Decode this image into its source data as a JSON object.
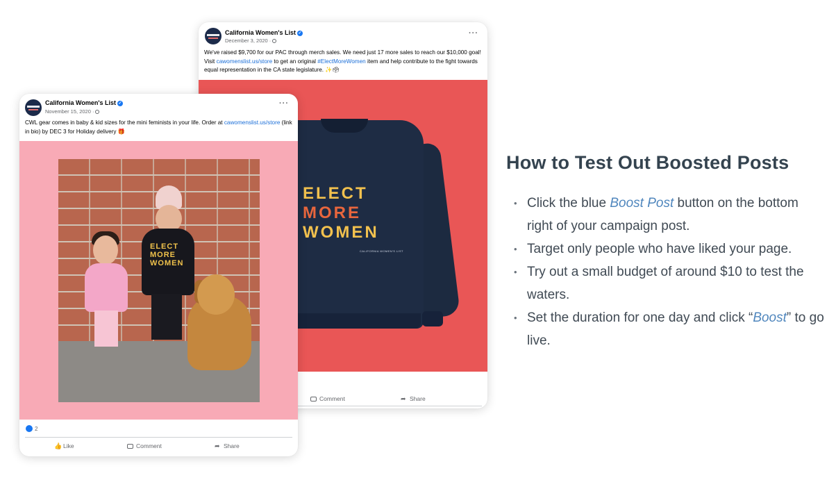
{
  "back_post": {
    "page_name": "California Women's List",
    "date": "December 3, 2020 ·",
    "text_1": "We've raised $9,700 for our PAC through merch sales. We need just 17 more sales to reach our $10,000 goal! Visit ",
    "link_1": "cawomenslist.us/store",
    "text_2": " to get an original ",
    "link_2": "#ElectMoreWomen",
    "text_3": " item and help contribute to the fight towards equal representation in the CA state legislature. ✨🗳",
    "shirt_print": [
      "ELECT",
      "MORE",
      "WOMEN"
    ],
    "shirt_tag": "CALIFORNIA WOMEN'S LIST",
    "comment_label": "Comment",
    "share_label": "Share"
  },
  "front_post": {
    "page_name": "California Women's List",
    "date": "November 15, 2020 ·",
    "text_1": "CWL gear comes in baby & kid sizes for the mini feminists in your life. Order at ",
    "link_1": "cawomenslist.us/store",
    "text_2": " (link in bio) by DEC 3 for Holiday delivery 🎁",
    "reaction_count": "2",
    "like_label": "Like",
    "comment_label": "Comment",
    "share_label": "Share",
    "kid_print": "ELECT MORE WOMEN"
  },
  "panel": {
    "heading": "How to Test Out Boosted Posts",
    "tip1_a": "Click the blue ",
    "tip1_hl": "Boost Post",
    "tip1_b": " button on the bottom right of your campaign post.",
    "tip2": "Target only people who have liked your page.",
    "tip3": "Try out a small budget of around $10 to test the waters.",
    "tip4_a": "Set the duration for one day and click “",
    "tip4_hl": "Boost",
    "tip4_b": "” to go live."
  },
  "colors": {
    "facebook_blue": "#1877f2",
    "link_blue": "#1a6ed8",
    "highlight_blue": "#4f86bd",
    "heading_text": "#34434f",
    "sweater_bg": "#e95656",
    "pink_bg": "#f8aab6"
  }
}
